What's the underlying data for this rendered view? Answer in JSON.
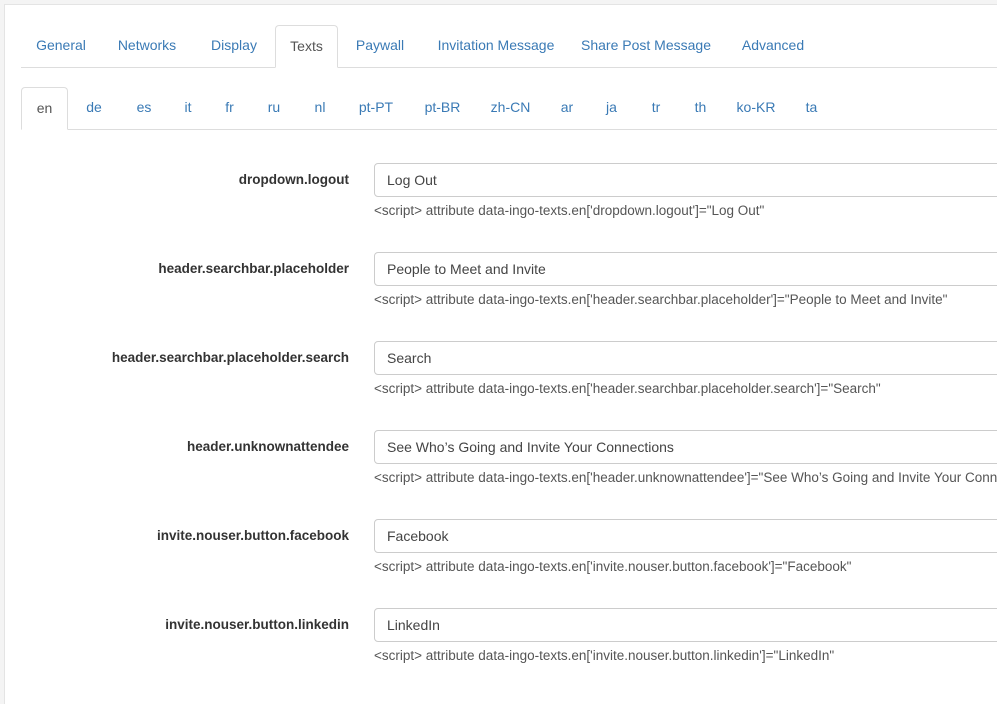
{
  "main_tabs": [
    {
      "label": "General",
      "active": false
    },
    {
      "label": "Networks",
      "active": false
    },
    {
      "label": "Display",
      "active": false
    },
    {
      "label": "Texts",
      "active": true
    },
    {
      "label": "Paywall",
      "active": false
    },
    {
      "label": "Invitation Message",
      "active": false
    },
    {
      "label": "Share Post Message",
      "active": false
    },
    {
      "label": "Advanced",
      "active": false
    }
  ],
  "lang_tabs": [
    {
      "label": "en",
      "active": true
    },
    {
      "label": "de",
      "active": false
    },
    {
      "label": "es",
      "active": false
    },
    {
      "label": "it",
      "active": false
    },
    {
      "label": "fr",
      "active": false
    },
    {
      "label": "ru",
      "active": false
    },
    {
      "label": "nl",
      "active": false
    },
    {
      "label": "pt-PT",
      "active": false
    },
    {
      "label": "pt-BR",
      "active": false
    },
    {
      "label": "zh-CN",
      "active": false
    },
    {
      "label": "ar",
      "active": false
    },
    {
      "label": "ja",
      "active": false
    },
    {
      "label": "tr",
      "active": false
    },
    {
      "label": "th",
      "active": false
    },
    {
      "label": "ko-KR",
      "active": false
    },
    {
      "label": "ta",
      "active": false
    }
  ],
  "fields": [
    {
      "label": "dropdown.logout",
      "value": "Log Out",
      "help": "<script> attribute data-ingo-texts.en['dropdown.logout']=\"Log Out\""
    },
    {
      "label": "header.searchbar.placeholder",
      "value": "People to Meet and Invite",
      "help": "<script> attribute data-ingo-texts.en['header.searchbar.placeholder']=\"People to Meet and Invite\""
    },
    {
      "label": "header.searchbar.placeholder.search",
      "value": "Search",
      "help": "<script> attribute data-ingo-texts.en['header.searchbar.placeholder.search']=\"Search\""
    },
    {
      "label": "header.unknownattendee",
      "value": "See Who’s Going and Invite Your Connections",
      "help": "<script> attribute data-ingo-texts.en['header.unknownattendee']=\"See Who’s Going and Invite Your Connections\""
    },
    {
      "label": "invite.nouser.button.facebook",
      "value": "Facebook",
      "help": "<script> attribute data-ingo-texts.en['invite.nouser.button.facebook']=\"Facebook\""
    },
    {
      "label": "invite.nouser.button.linkedin",
      "value": "LinkedIn",
      "help": "<script> attribute data-ingo-texts.en['invite.nouser.button.linkedin']=\"LinkedIn\""
    }
  ]
}
